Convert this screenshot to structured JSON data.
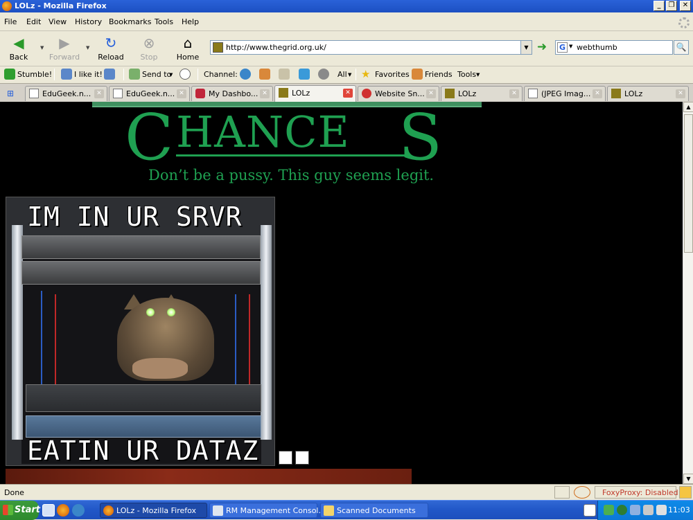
{
  "window": {
    "title": "LOLz - Mozilla Firefox"
  },
  "menu": [
    "File",
    "Edit",
    "View",
    "History",
    "Bookmarks",
    "Tools",
    "Help"
  ],
  "nav": {
    "back": "Back",
    "forward": "Forward",
    "reload": "Reload",
    "stop": "Stop",
    "home": "Home"
  },
  "url": "http://www.thegrid.org.uk/",
  "search": {
    "engine": "G",
    "value": "webthumb"
  },
  "stumble": {
    "stumble": "Stumble!",
    "like": "I like it!",
    "sendto": "Send to",
    "channel": "Channel:",
    "all": "All",
    "favorites": "Favorites",
    "friends": "Friends",
    "tools": "Tools"
  },
  "tabs": [
    {
      "label": "EduGeek.n...",
      "active": false
    },
    {
      "label": "EduGeek.n...",
      "active": false
    },
    {
      "label": "My Dashbo...",
      "active": false
    },
    {
      "label": "LOLz",
      "active": true
    },
    {
      "label": "Website Sn...",
      "active": false
    },
    {
      "label": "LOLz",
      "active": false
    },
    {
      "label": "(JPEG Imag...",
      "active": false
    },
    {
      "label": "LOLz",
      "active": false
    }
  ],
  "page": {
    "heading_first": "C",
    "heading_mid": "HANCE",
    "heading_last": "S",
    "tagline": "Don’t be a pussy. This guy seems legit.",
    "caption_top": "IM IN UR SRVR",
    "caption_bottom": "EATIN UR DATAZ"
  },
  "status": {
    "text": "Done",
    "foxyproxy": "FoxyProxy: Disabled"
  },
  "taskbar": {
    "start": "Start",
    "buttons": [
      {
        "label": "LOLz - Mozilla Firefox",
        "active": true
      },
      {
        "label": "RM Management Consol...",
        "active": false
      },
      {
        "label": "Scanned Documents",
        "active": false
      }
    ],
    "clock": "11:03"
  },
  "colors": {
    "heading": "#1fa051",
    "page_bg": "#000000",
    "titlebar": "#2a62d8",
    "foxyproxy": "#c0392b"
  }
}
